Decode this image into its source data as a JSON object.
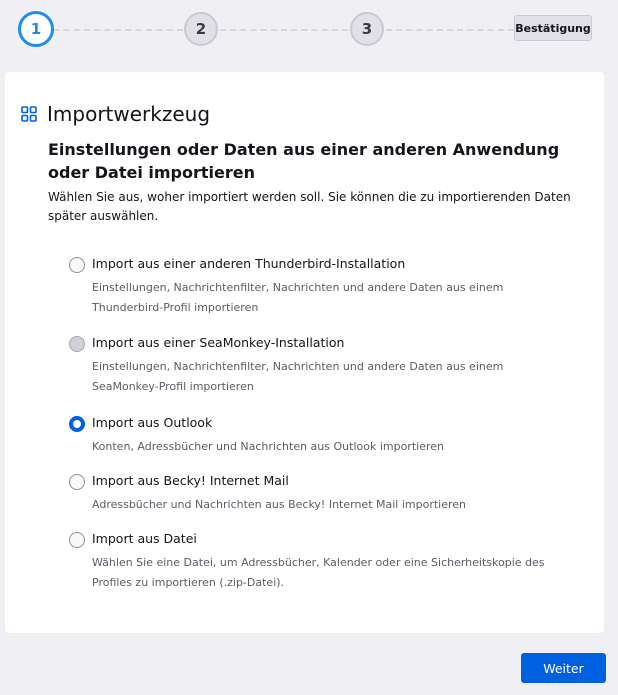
{
  "stepper": {
    "steps": [
      "1",
      "2",
      "3"
    ],
    "final_label": "Bestätigung"
  },
  "page": {
    "title": "Importwerkzeug",
    "heading": "Einstellungen oder Daten aus einer anderen Anwendung oder Datei importieren",
    "description": "Wählen Sie aus, woher importiert werden soll. Sie können die zu importierenden Daten später auswählen."
  },
  "options": [
    {
      "label": "Import aus einer anderen Thunderbird-Installation",
      "sub": "Einstellungen, Nachrichtenfilter, Nachrichten und andere Daten aus einem Thunderbird-Profil importieren",
      "state": "unchecked"
    },
    {
      "label": "Import aus einer SeaMonkey-Installation",
      "sub": "Einstellungen, Nachrichtenfilter, Nachrichten und andere Daten aus einem SeaMonkey-Profil importieren",
      "state": "disabled"
    },
    {
      "label": "Import aus Outlook",
      "sub": "Konten, Adressbücher und Nachrichten aus Outlook importieren",
      "state": "checked"
    },
    {
      "label": "Import aus Becky! Internet Mail",
      "sub": "Adressbücher und Nachrichten aus Becky! Internet Mail importieren",
      "state": "unchecked"
    },
    {
      "label": "Import aus Datei",
      "sub": "Wählen Sie eine Datei, um Adressbücher, Kalender oder eine Sicherheitskopie des Profiles zu importieren (.zip-Datei).",
      "state": "unchecked"
    }
  ],
  "footer": {
    "next_label": "Weiter"
  },
  "colors": {
    "accent": "#0061e0",
    "active_step": "#1c8df0"
  }
}
